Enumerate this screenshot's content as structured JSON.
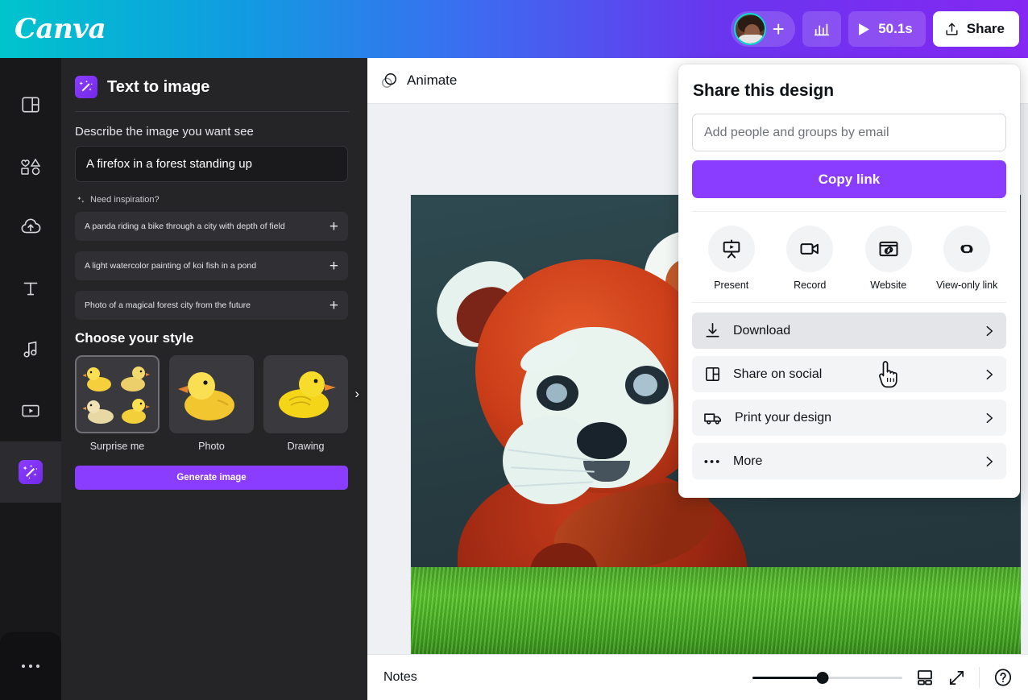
{
  "brand": {
    "logo_text": "Canva",
    "accent_purple": "#8b3dff",
    "accent_teal": "#00c4cc"
  },
  "topbar": {
    "logo": "Canva",
    "add_member_icon": "plus-icon",
    "avatar_icon": "user-avatar",
    "stats_icon": "bar-chart-icon",
    "play_icon": "play-icon",
    "duration": "50.1s",
    "share_label": "Share",
    "share_icon": "share-upload-icon"
  },
  "rail": {
    "items": [
      {
        "icon": "design-layout-icon",
        "name": "design"
      },
      {
        "icon": "elements-shapes-icon",
        "name": "elements"
      },
      {
        "icon": "upload-cloud-icon",
        "name": "uploads"
      },
      {
        "icon": "text-t-icon",
        "name": "text"
      },
      {
        "icon": "music-note-icon",
        "name": "audio"
      },
      {
        "icon": "video-play-icon",
        "name": "videos"
      },
      {
        "icon": "magic-apps-icon",
        "name": "apps",
        "active": true
      }
    ],
    "more_icon": "ellipsis-icon"
  },
  "panel": {
    "app_icon": "magic-wand-icon",
    "title": "Text to image",
    "prompt_label": "Describe the image you want see",
    "prompt_value": "A firefox in a forest standing up",
    "inspiration_icon": "sparkle-icon",
    "inspiration_label": "Need inspiration?",
    "suggestions": [
      {
        "text": "A panda riding a bike through a city with depth of field",
        "add_icon": "plus-icon"
      },
      {
        "text": "A light watercolor painting of koi fish in a pond",
        "add_icon": "plus-icon"
      },
      {
        "text": "Photo of a magical forest city from the future",
        "add_icon": "plus-icon"
      }
    ],
    "style_title": "Choose your style",
    "styles": [
      {
        "label": "Surprise me",
        "thumb": "duck-grid-thumbnail",
        "selected": true
      },
      {
        "label": "Photo",
        "thumb": "duck-photo-thumbnail",
        "selected": false
      },
      {
        "label": "Drawing",
        "thumb": "duck-drawing-thumbnail",
        "selected": false
      }
    ],
    "carousel_next_icon": "chevron-right-icon",
    "generate_label": "Generate image"
  },
  "editor": {
    "toolbar": {
      "animate_label": "Animate",
      "animate_icon": "animate-circles-icon"
    },
    "canvas": {
      "artwork": "red-panda-in-grass-illustration"
    },
    "bottom": {
      "notes_label": "Notes",
      "zoom_percent": 47,
      "pages_icon": "grid-pages-icon",
      "fullscreen_icon": "expand-arrows-icon",
      "help_icon": "question-mark-icon"
    }
  },
  "share_panel": {
    "title": "Share this design",
    "email_placeholder": "Add people and groups by email",
    "email_value": "",
    "copy_link_label": "Copy link",
    "actions": [
      {
        "label": "Present",
        "icon": "presentation-screen-icon"
      },
      {
        "label": "Record",
        "icon": "video-camera-icon"
      },
      {
        "label": "Website",
        "icon": "browser-window-link-icon"
      },
      {
        "label": "View-only link",
        "icon": "chain-link-icon"
      }
    ],
    "rows": [
      {
        "label": "Download",
        "icon": "download-arrow-icon",
        "chevron": "chevron-right-icon",
        "hovered": true
      },
      {
        "label": "Share on social",
        "icon": "social-layout-icon",
        "chevron": "chevron-right-icon",
        "hovered": false
      },
      {
        "label": "Print your design",
        "icon": "delivery-truck-icon",
        "chevron": "chevron-right-icon",
        "hovered": false
      },
      {
        "label": "More",
        "icon": "ellipsis-icon",
        "chevron": "chevron-right-icon",
        "hovered": false
      }
    ]
  },
  "cursor": {
    "icon": "pointing-hand-cursor"
  }
}
